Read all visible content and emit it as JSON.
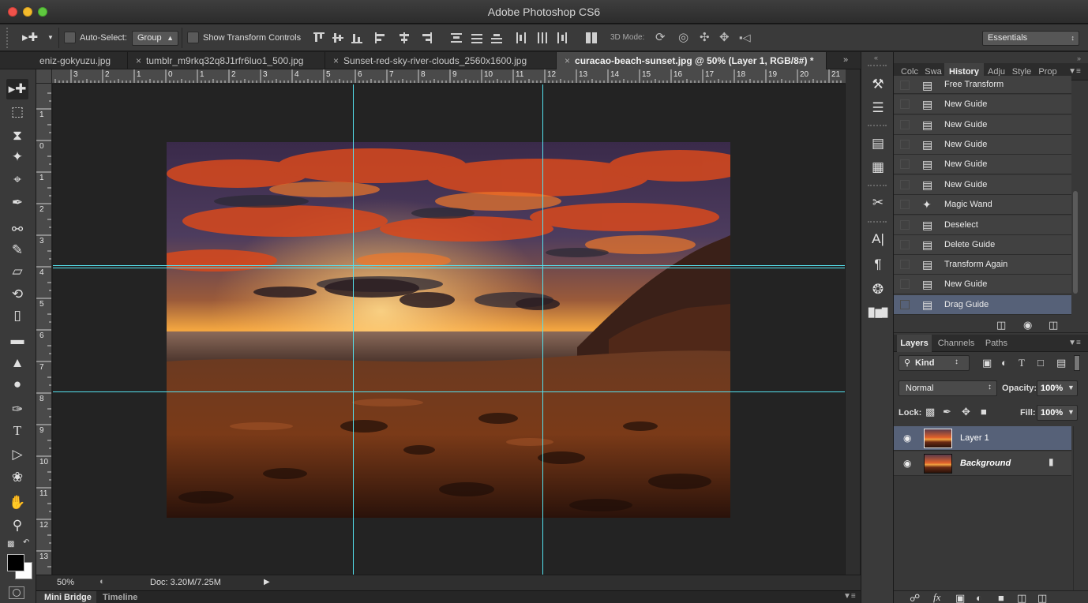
{
  "window": {
    "title": "Adobe Photoshop CS6"
  },
  "options_bar": {
    "auto_select_label": "Auto-Select:",
    "auto_select_value": "Group",
    "show_transform_label": "Show Transform Controls",
    "mode_3d_label": "3D Mode:",
    "workspace": "Essentials"
  },
  "doc_tabs": [
    {
      "label": "eniz-gokyuzu.jpg",
      "active": false
    },
    {
      "label": "tumblr_m9rkq32q8J1rfr6luo1_500.jpg",
      "active": false
    },
    {
      "label": "Sunset-red-sky-river-clouds_2560x1600.jpg",
      "active": false
    },
    {
      "label": "curacao-beach-sunset.jpg @ 50% (Layer 1, RGB/8#) *",
      "active": true
    }
  ],
  "ruler": {
    "top_ticks": [
      "3",
      "2",
      "1",
      "0",
      "1",
      "2",
      "3",
      "4",
      "5",
      "6",
      "7",
      "8",
      "9",
      "10",
      "11",
      "12",
      "13",
      "14",
      "15",
      "16",
      "17",
      "18",
      "19",
      "20",
      "21"
    ],
    "left_ticks": [
      "1",
      "0",
      "1",
      "2",
      "3",
      "4",
      "5",
      "6",
      "7",
      "8",
      "9",
      "10",
      "11",
      "12",
      "13"
    ]
  },
  "status": {
    "zoom": "50%",
    "doc": "Doc: 3.20M/7.25M"
  },
  "bottom_tabs": [
    "Mini Bridge",
    "Timeline"
  ],
  "history_panel": {
    "tabs": [
      "Colc",
      "Swa",
      "History",
      "Adju",
      "Style",
      "Prop"
    ],
    "active_tab": "History",
    "items": [
      {
        "label": "Free Transform",
        "icon": "document-icon",
        "selected": false
      },
      {
        "label": "New Guide",
        "icon": "document-icon",
        "selected": false
      },
      {
        "label": "New Guide",
        "icon": "document-icon",
        "selected": false
      },
      {
        "label": "New Guide",
        "icon": "document-icon",
        "selected": false
      },
      {
        "label": "New Guide",
        "icon": "document-icon",
        "selected": false
      },
      {
        "label": "New Guide",
        "icon": "document-icon",
        "selected": false
      },
      {
        "label": "Magic Wand",
        "icon": "magic-wand-icon",
        "selected": false
      },
      {
        "label": "Deselect",
        "icon": "document-icon",
        "selected": false
      },
      {
        "label": "Delete Guide",
        "icon": "document-icon",
        "selected": false
      },
      {
        "label": "Transform Again",
        "icon": "document-icon",
        "selected": false
      },
      {
        "label": "New Guide",
        "icon": "document-icon",
        "selected": false
      },
      {
        "label": "Drag Guide",
        "icon": "document-icon",
        "selected": true
      }
    ]
  },
  "layers_panel": {
    "tabs": [
      "Layers",
      "Channels",
      "Paths"
    ],
    "filter_kind": "Kind",
    "blend_mode": "Normal",
    "opacity_label": "Opacity:",
    "opacity_value": "100%",
    "lock_label": "Lock:",
    "fill_label": "Fill:",
    "fill_value": "100%",
    "layers": [
      {
        "name": "Layer 1",
        "selected": true,
        "locked": false,
        "visible": true
      },
      {
        "name": "Background",
        "selected": false,
        "locked": true,
        "visible": true
      }
    ]
  },
  "colors": {
    "guide": "#54e1ee",
    "selection": "#566178",
    "panel_bg": "#383838",
    "canvas_bg": "#232323"
  }
}
